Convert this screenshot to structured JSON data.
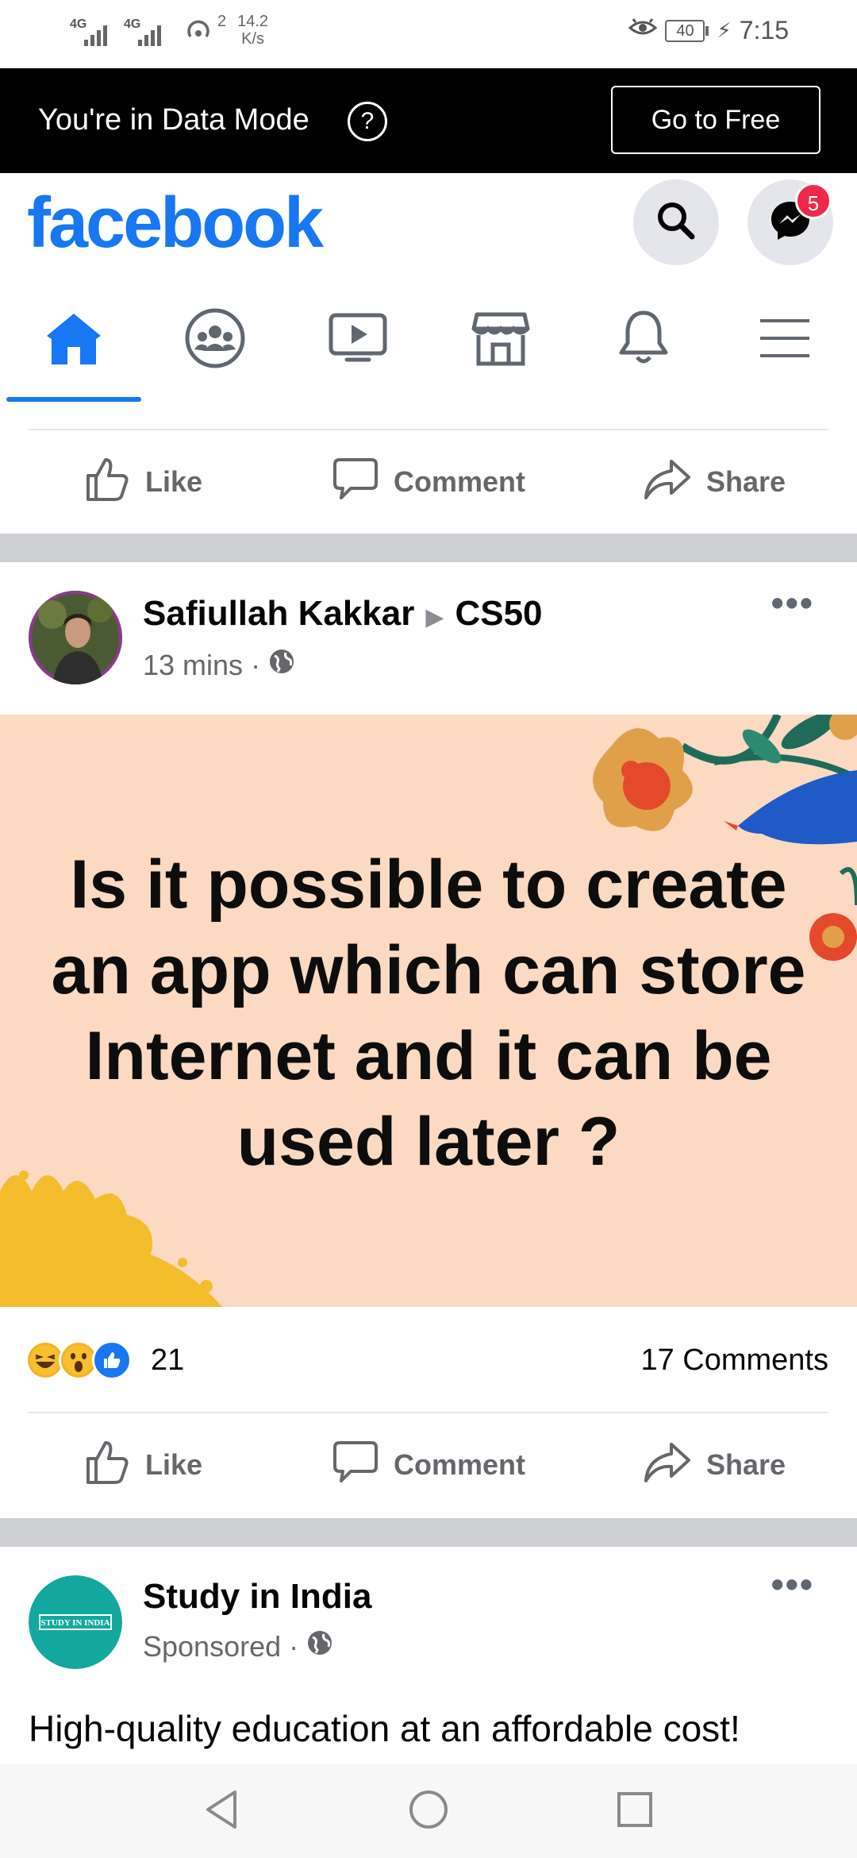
{
  "status_bar": {
    "network1": "4G",
    "network2": "4G",
    "wifi_superscript": "2",
    "speed_value": "14.2",
    "speed_unit": "K/s",
    "battery": "40",
    "time": "7:15"
  },
  "data_mode": {
    "message": "You're in Data Mode",
    "help_glyph": "?",
    "go_free_label": "Go to Free"
  },
  "header": {
    "logo": "facebook",
    "messenger_badge": "5",
    "brand_color": "#1877f2"
  },
  "nav_tabs": [
    {
      "icon": "home-icon",
      "active": true
    },
    {
      "icon": "groups-icon",
      "active": false
    },
    {
      "icon": "watch-icon",
      "active": false
    },
    {
      "icon": "marketplace-icon",
      "active": false
    },
    {
      "icon": "notifications-icon",
      "active": false
    },
    {
      "icon": "menu-icon",
      "active": false
    }
  ],
  "actions": {
    "like": "Like",
    "comment": "Comment",
    "share": "Share"
  },
  "post1": {
    "author": "Safiullah Kakkar",
    "group": "CS50",
    "time": "13 mins",
    "more": "•••",
    "image_text": "Is it possible to create an app which can store Internet and it can be used later ?",
    "reaction_count": "21",
    "comments": "17 Comments"
  },
  "post2": {
    "author": "Study in India",
    "time": "Sponsored",
    "more": "•••",
    "avatar_text": "STUDY IN INDIA",
    "text": "High-quality education at an affordable cost!"
  }
}
